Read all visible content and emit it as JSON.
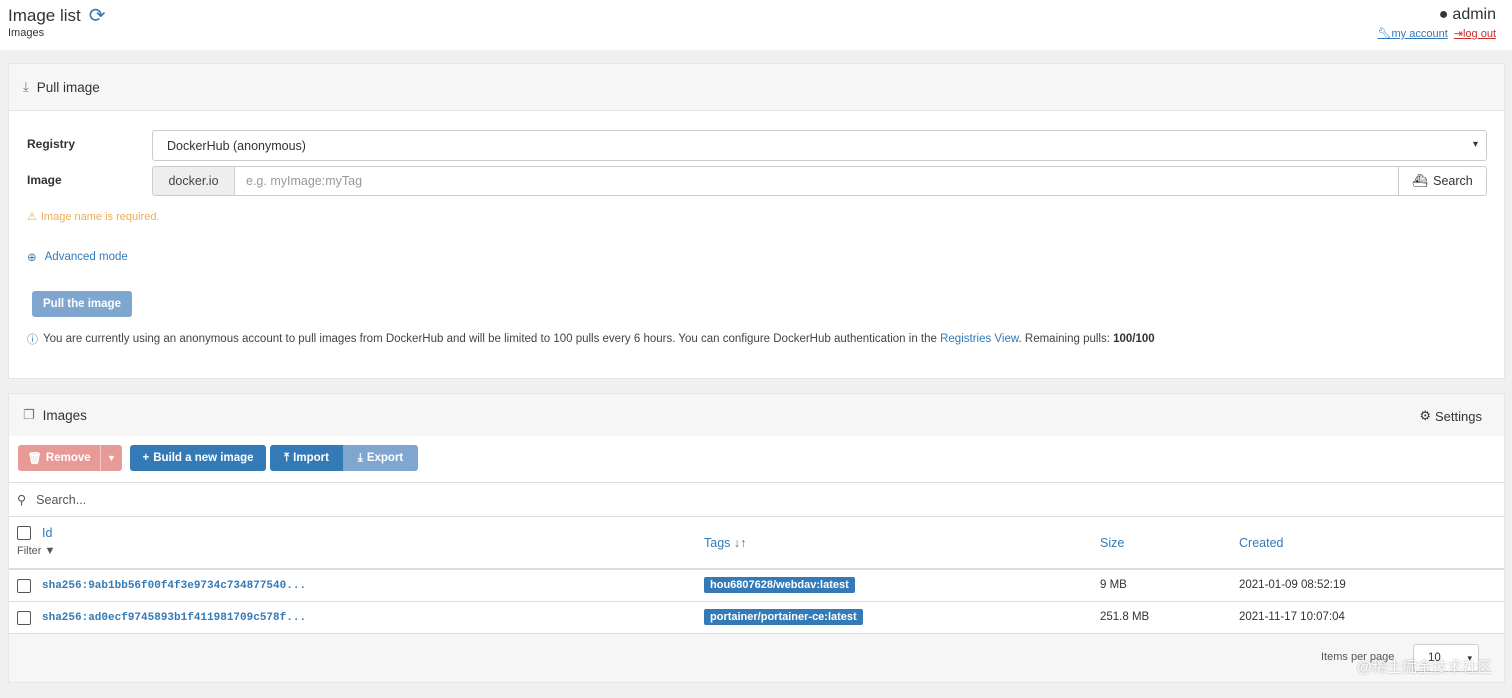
{
  "header": {
    "title": "Image list",
    "subtitle": "Images",
    "username": "admin",
    "my_account": "my account",
    "log_out": "log out"
  },
  "pull_panel": {
    "title": "Pull image",
    "registry_label": "Registry",
    "registry_value": "DockerHub (anonymous)",
    "image_label": "Image",
    "image_prefix": "docker.io",
    "image_placeholder": "e.g. myImage:myTag",
    "search_label": "Search",
    "warning": "Image name is required.",
    "advanced_mode": "Advanced mode",
    "pull_button": "Pull the image",
    "info_text": "You are currently using an anonymous account to pull images from DockerHub and will be limited to 100 pulls every 6 hours. You can configure DockerHub authentication in the",
    "info_link": "Registries View",
    "info_remaining_label": ". Remaining pulls:",
    "info_remaining_value": "100/100"
  },
  "images_panel": {
    "title": "Images",
    "settings": "Settings",
    "buttons": {
      "remove": "Remove",
      "build": "Build a new image",
      "import": "Import",
      "export": "Export"
    },
    "search_placeholder": "Search...",
    "columns": {
      "id": "Id",
      "filter": "Filter",
      "tags": "Tags",
      "size": "Size",
      "created": "Created"
    },
    "rows": [
      {
        "id": "sha256:9ab1bb56f00f4f3e9734c734877540...",
        "tag": "hou6807628/webdav:latest",
        "size": "9 MB",
        "created": "2021-01-09 08:52:19"
      },
      {
        "id": "sha256:ad0ecf9745893b1f411981709c578f...",
        "tag": "portainer/portainer-ce:latest",
        "size": "251.8 MB",
        "created": "2021-11-17 10:07:04"
      }
    ],
    "items_per_page_label": "Items per page",
    "items_per_page_value": "10"
  },
  "watermark": "@稀土掘金技术社区",
  "colors": {
    "primary": "#337ab7",
    "danger_light": "#e89a97",
    "warning": "#f0ad4e",
    "primary_light": "#7fa6cf"
  }
}
